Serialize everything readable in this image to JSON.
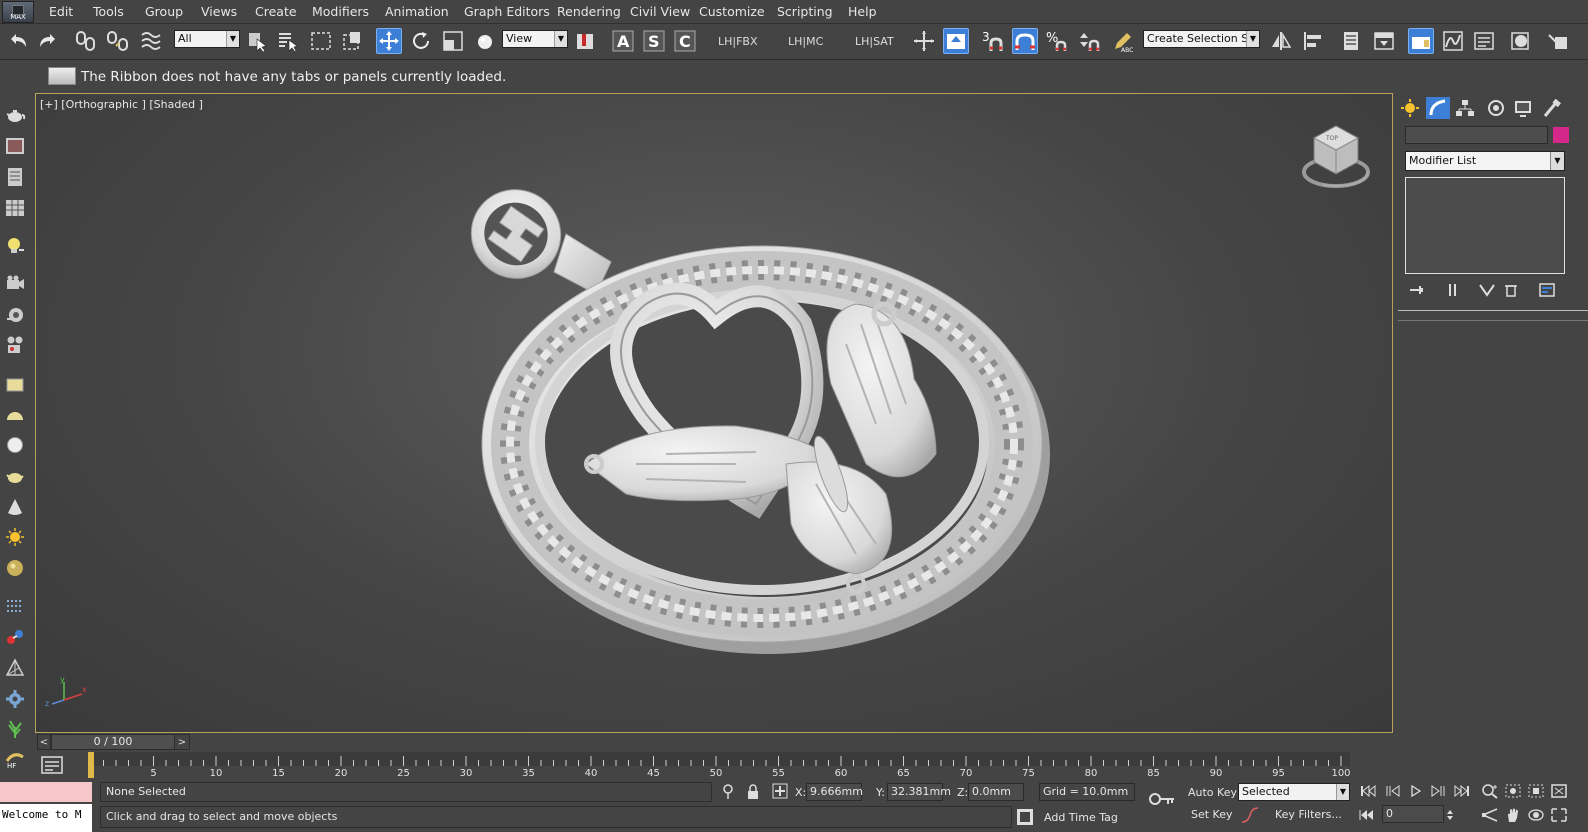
{
  "app": {
    "logo": "MAX",
    "menu": [
      "Edit",
      "Tools",
      "Group",
      "Views",
      "Create",
      "Modifiers",
      "Animation",
      "Graph Editors",
      "Rendering",
      "Civil View",
      "Customize",
      "Scripting",
      "Help"
    ]
  },
  "toolbar": {
    "selection_filter": "All",
    "ref_coord": "View",
    "named_selection_placeholder": "Create Selection Se",
    "snap_labels": [
      "LH|FBX",
      "LH|MC",
      "LH|SAT"
    ],
    "angle_snap_digit": "3",
    "percent_snap": "%"
  },
  "ribbon": {
    "message": "The Ribbon does not have any tabs or panels currently loaded."
  },
  "viewport": {
    "label": "[+] [Orthographic ] [Shaded ]",
    "model_color": "#e9e9e9"
  },
  "command_panel": {
    "modifier_list": "Modifier List",
    "object_color": "#d4298a"
  },
  "timeline": {
    "frame_display": "0 / 100",
    "prev": "<",
    "next": ">",
    "ticks": [
      "5",
      "10",
      "15",
      "20",
      "25",
      "30",
      "35",
      "40",
      "45",
      "50",
      "55",
      "60",
      "65",
      "70",
      "75",
      "80",
      "85",
      "90",
      "95",
      "100"
    ]
  },
  "status": {
    "welcome": "Welcome to M",
    "selection": "None Selected",
    "prompt": "Click and drag to select and move objects",
    "x_label": "X:",
    "x_value": "9.666mm",
    "y_label": "Y:",
    "y_value": "32.381mm",
    "z_label": "Z:",
    "z_value": "0.0mm",
    "grid": "Grid = 10.0mm",
    "add_time_tag": "Add Time Tag",
    "auto_key": "Auto Key",
    "set_key": "Set Key",
    "key_mode": "Selected",
    "key_filters": "Key Filters...",
    "current_frame": "0"
  }
}
